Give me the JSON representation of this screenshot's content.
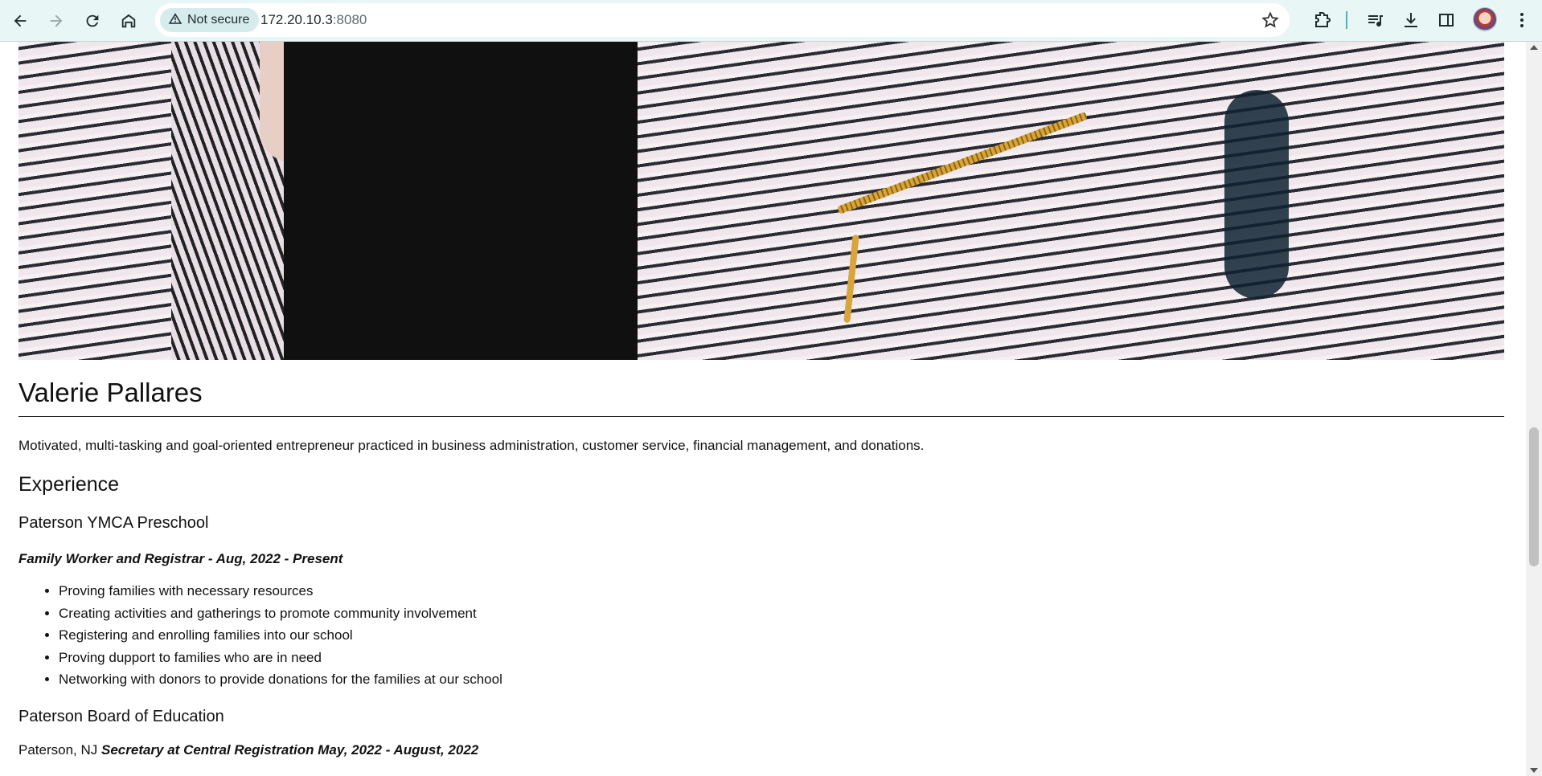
{
  "browser": {
    "security_label": "Not secure",
    "url_host": "172.20.10.3",
    "url_port": ":8080",
    "icons": [
      "back-arrow-icon",
      "forward-arrow-icon",
      "reload-icon",
      "home-icon",
      "warning-triangle-icon",
      "bookmark-star-icon",
      "extensions-puzzle-icon",
      "media-queue-icon",
      "download-icon",
      "side-panel-icon",
      "profile-avatar-icon",
      "menu-dots-icon"
    ],
    "accent_color": "#49b6b6"
  },
  "page": {
    "name": "Valerie Pallares",
    "summary": "Motivated, multi-tasking and goal-oriented entrepreneur practiced in business administration, customer service, financial management, and donations.",
    "experience_heading": "Experience",
    "jobs": [
      {
        "org": "Paterson YMCA Preschool",
        "role": "Family Worker and Registrar - Aug, 2022 - Present",
        "duties": [
          "Proving families with necessary resources",
          "Creating activities and gatherings to promote community involvement",
          "Registering and enrolling families into our school",
          "Proving dupport to families who are in need",
          "Networking with donors to provide donations for the families at our school"
        ]
      },
      {
        "org": "Paterson Board of Education",
        "location": "Paterson, NJ",
        "role": "Secretary at Central Registration May, 2022 - August, 2022"
      }
    ]
  }
}
